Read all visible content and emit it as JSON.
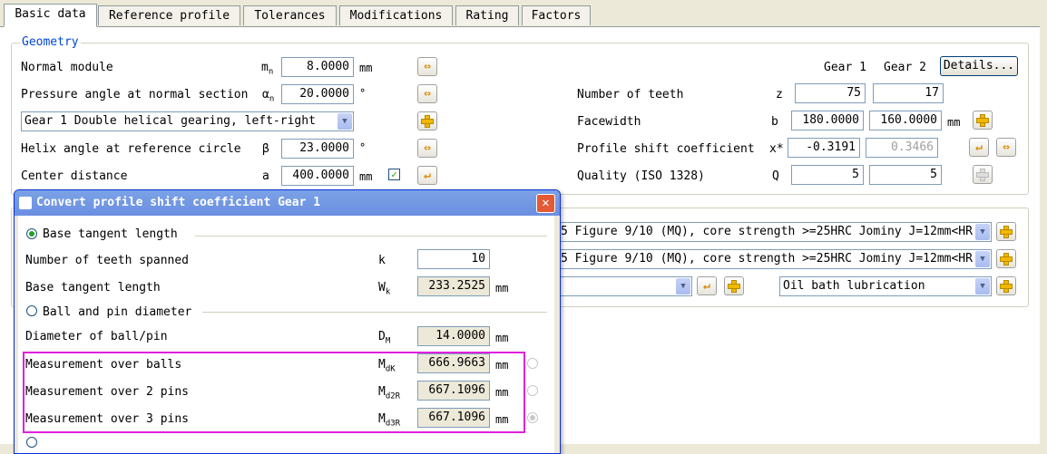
{
  "tabs": [
    "Basic data",
    "Reference profile",
    "Tolerances",
    "Modifications",
    "Rating",
    "Factors"
  ],
  "geometry": {
    "title": "Geometry",
    "normal_module": {
      "label": "Normal module",
      "sym": "m",
      "sub": "n",
      "value": "8.0000",
      "unit": "mm"
    },
    "pressure_angle": {
      "label": "Pressure angle at normal section",
      "sym": "α",
      "sub": "n",
      "value": "20.0000",
      "unit": "°"
    },
    "gearing_select": "Gear 1 Double helical gearing, left-right",
    "helix_angle": {
      "label": "Helix angle at reference circle",
      "sym": "β",
      "value": "23.0000",
      "unit": "°"
    },
    "center_distance": {
      "label": "Center distance",
      "sym": "a",
      "value": "400.0000",
      "unit": "mm",
      "checked": true
    },
    "gear1_header": "Gear 1",
    "gear2_header": "Gear 2",
    "details_button": "Details...",
    "teeth": {
      "label": "Number of teeth",
      "sym": "z",
      "g1": "75",
      "g2": "17"
    },
    "facewidth": {
      "label": "Facewidth",
      "sym": "b",
      "g1": "180.0000",
      "g2": "160.0000",
      "unit": "mm"
    },
    "profile_shift": {
      "label": "Profile shift coefficient",
      "sym": "x*",
      "g1": "-0.3191",
      "g2": "0.3466"
    },
    "quality": {
      "label": "Quality (ISO 1328)",
      "sym": "Q",
      "g1": "5",
      "g2": "5"
    }
  },
  "material": {
    "row1": "5 Figure 9/10 (MQ), core strength >=25HRC Jominy J=12mm<HR",
    "row2": "5 Figure 9/10 (MQ), core strength >=25HRC Jominy J=12mm<HR",
    "row3_left": "",
    "lubrication": "Oil bath lubrication"
  },
  "dialog": {
    "title": "Convert profile shift coefficient Gear 1",
    "close": "✕",
    "base_tangent": {
      "label": "Base tangent length",
      "selected": true
    },
    "teeth_spanned": {
      "label": "Number of teeth spanned",
      "sym": "k",
      "value": "10"
    },
    "base_tangent_length": {
      "label": "Base tangent length",
      "sym": "W",
      "sub": "k",
      "value": "233.2525",
      "unit": "mm"
    },
    "ball_pin": {
      "label": "Ball and pin diameter",
      "selected": false
    },
    "diameter": {
      "label": "Diameter of ball/pin",
      "sym": "D",
      "sub": "M",
      "value": "14.0000",
      "unit": "mm"
    },
    "over_balls": {
      "label": "Measurement over balls",
      "sym": "M",
      "sub": "dK",
      "value": "666.9663",
      "unit": "mm"
    },
    "over_2pins": {
      "label": "Measurement over 2 pins",
      "sym": "M",
      "sub": "d2R",
      "value": "667.1096",
      "unit": "mm"
    },
    "over_3pins": {
      "label": "Measurement over 3 pins",
      "sym": "M",
      "sub": "d3R",
      "value": "667.1096",
      "unit": "mm"
    }
  },
  "colors": {
    "highlight": "#e020e0",
    "group_title": "#0046d5",
    "title_bar": "#6a8ee0"
  }
}
